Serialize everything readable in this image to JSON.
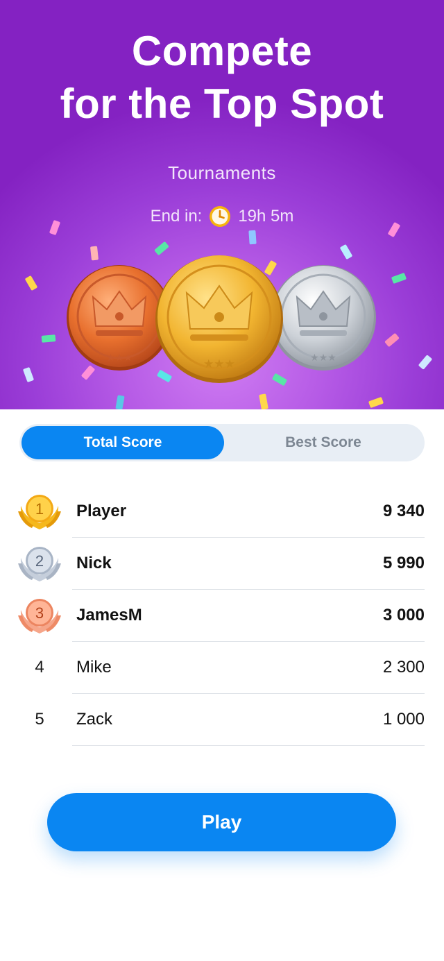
{
  "hero": {
    "title_line1": "Compete",
    "title_line2": "for the Top Spot",
    "subtitle": "Tournaments",
    "timer_label": "End in:",
    "timer_value": "19h 5m",
    "timer_icon": "clock-icon",
    "coins": [
      "bronze-crown-coin",
      "gold-crown-coin",
      "silver-crown-coin"
    ]
  },
  "tabs": {
    "active": "Total Score",
    "inactive": "Best Score"
  },
  "leaderboard": [
    {
      "rank": "1",
      "name": "Player",
      "score": "9 340",
      "medal": "gold"
    },
    {
      "rank": "2",
      "name": "Nick",
      "score": "5 990",
      "medal": "silver"
    },
    {
      "rank": "3",
      "name": "JamesM",
      "score": "3 000",
      "medal": "bronze"
    },
    {
      "rank": "4",
      "name": "Mike",
      "score": "2 300",
      "medal": null
    },
    {
      "rank": "5",
      "name": "Zack",
      "score": "1 000",
      "medal": null
    }
  ],
  "play_label": "Play",
  "colors": {
    "hero_purple": "#9b3ed8",
    "accent_blue": "#0a86f2",
    "gold": "#f5b81c",
    "silver": "#b9c3d3",
    "bronze": "#f0906a"
  }
}
